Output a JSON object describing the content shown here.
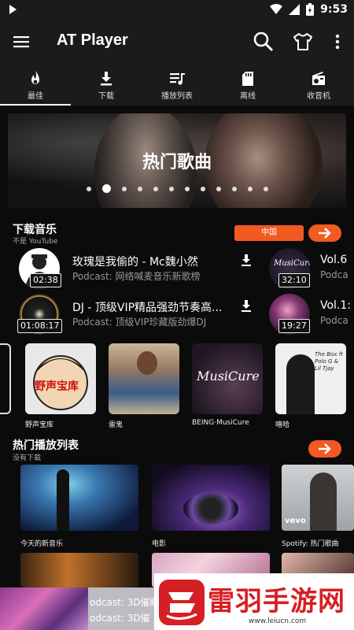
{
  "status_bar": {
    "time": "9:53"
  },
  "app_bar": {
    "title": "AT Player"
  },
  "tabs": [
    {
      "label": "最佳",
      "icon": "flame-icon",
      "active": true
    },
    {
      "label": "下载",
      "icon": "download-icon",
      "active": false
    },
    {
      "label": "播放列表",
      "icon": "playlist-icon",
      "active": false
    },
    {
      "label": "离线",
      "icon": "sd-card-icon",
      "active": false
    },
    {
      "label": "收音机",
      "icon": "radio-icon",
      "active": false
    }
  ],
  "banner": {
    "title": "热门歌曲",
    "dot_count": 12,
    "active_dot": 1
  },
  "download_section": {
    "title": "下载音乐",
    "subtitle": "不是 YouTube",
    "country": "中国",
    "podcasts": [
      {
        "title": "玫瑰是我偷的 - Mc魏小然",
        "source": "Podcast: 网络喊麦音乐新歌榜",
        "duration": "02:38"
      },
      {
        "title": "DJ - 顶级VIP精品强劲节奏高...",
        "source": "Podcast: 顶级VIP珍藏版劲爆DJ",
        "duration": "01:08:17"
      },
      {
        "title": "Vol.6",
        "source": "Podca",
        "duration": "32:10",
        "thumb_text": "MusiCure"
      },
      {
        "title": "Vol.1:",
        "source": "Podca",
        "duration": "19:27"
      }
    ]
  },
  "artists": [
    {
      "label": "野声宝库",
      "art_text": "野声宝库"
    },
    {
      "label": "雷鬼"
    },
    {
      "label": "BEING·MusiCure",
      "art_text": "MusiCure"
    },
    {
      "label": "嘻哈",
      "art_text": "The Box ft Polo G & Lil Tjay"
    }
  ],
  "playlist_section": {
    "title": "热门播放列表",
    "subtitle": "没有下载",
    "playlists": [
      {
        "label": "今天的新音乐"
      },
      {
        "label": "电影"
      },
      {
        "label": "Spotify: 热门歌曲",
        "badge": "vevo"
      }
    ]
  },
  "mini_player": {
    "line1": "odcast: 3D催眠",
    "line2": "odcast: 3D催"
  },
  "watermark": {
    "text": "雷羽手游网",
    "url": "www.leiucn.com"
  },
  "colors": {
    "accent": "#f25a22",
    "background": "#0b0b0b",
    "bar": "#1b1b1b",
    "watermark_red": "#d61f24"
  }
}
